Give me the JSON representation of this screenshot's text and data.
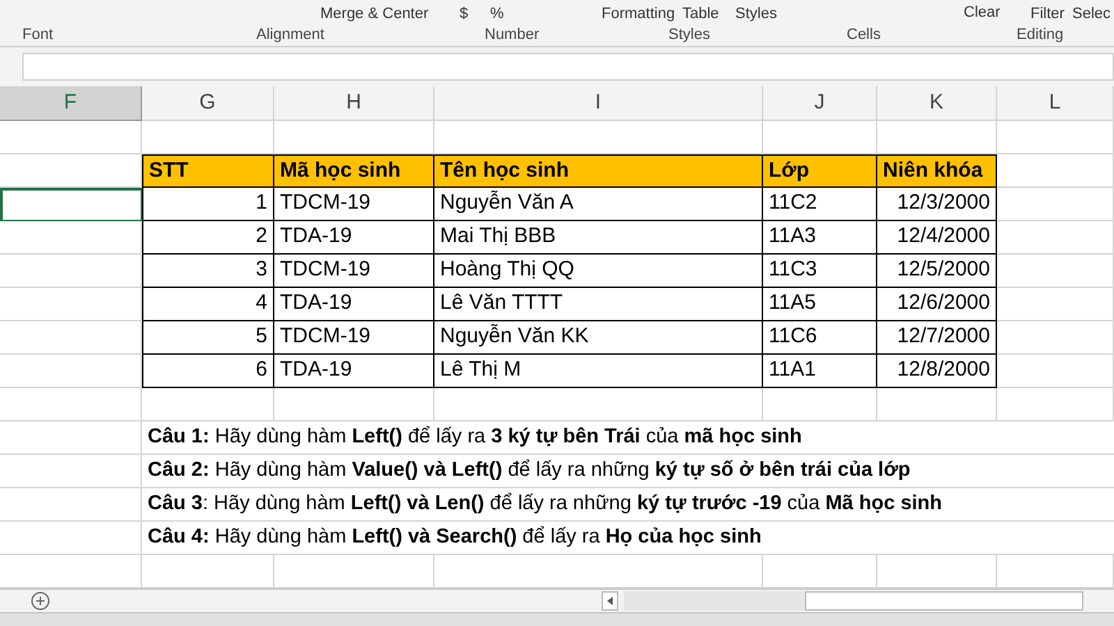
{
  "ribbon": {
    "controls": [
      "Merge & Center",
      "$",
      "%",
      "Formatting",
      "Table",
      "Styles",
      "Clear",
      "Filter",
      "Selec"
    ],
    "groups": [
      "Font",
      "Alignment",
      "Number",
      "Styles",
      "Cells",
      "Editing"
    ]
  },
  "columns": [
    {
      "label": "F",
      "selected": true
    },
    {
      "label": "G",
      "selected": false
    },
    {
      "label": "H",
      "selected": false
    },
    {
      "label": "I",
      "selected": false
    },
    {
      "label": "J",
      "selected": false
    },
    {
      "label": "K",
      "selected": false
    },
    {
      "label": "L",
      "selected": false
    }
  ],
  "table": {
    "header": [
      "STT",
      "Mã học sinh",
      "Tên học sinh",
      "Lớp",
      "Niên khóa"
    ],
    "rows": [
      {
        "cells": [
          "1",
          "TDCM-19",
          "Nguyễn Văn A",
          "11C2",
          "12/3/2000"
        ],
        "selected": true
      },
      {
        "cells": [
          "2",
          "TDA-19",
          "Mai Thị BBB",
          "11A3",
          "12/4/2000"
        ],
        "selected": false
      },
      {
        "cells": [
          "3",
          "TDCM-19",
          "Hoàng Thị QQ",
          "11C3",
          "12/5/2000"
        ],
        "selected": false
      },
      {
        "cells": [
          "4",
          "TDA-19",
          "Lê Văn TTTT",
          "11A5",
          "12/6/2000"
        ],
        "selected": false
      },
      {
        "cells": [
          "5",
          "TDCM-19",
          "Nguyễn Văn KK",
          "11C6",
          "12/7/2000"
        ],
        "selected": false
      },
      {
        "cells": [
          "6",
          "TDA-19",
          "Lê Thị M",
          "11A1",
          "12/8/2000"
        ],
        "selected": false
      }
    ]
  },
  "questions": [
    "**Câu 1:** Hãy dùng hàm **Left()** để lấy ra **3 ký tự bên Trái** của **mã học sinh**",
    "**Câu 2:** Hãy dùng hàm **Value() và Left()** để lấy ra những **ký tự số ở bên trái của lớp**",
    "**Câu 3**: Hãy dùng hàm **Left() và Len()** để lấy ra  những **ký tự trước -19** của **Mã học sinh**",
    "**Câu 4:** Hãy dùng hàm **Left() và Search()** để lấy ra **Họ của học sinh**"
  ]
}
